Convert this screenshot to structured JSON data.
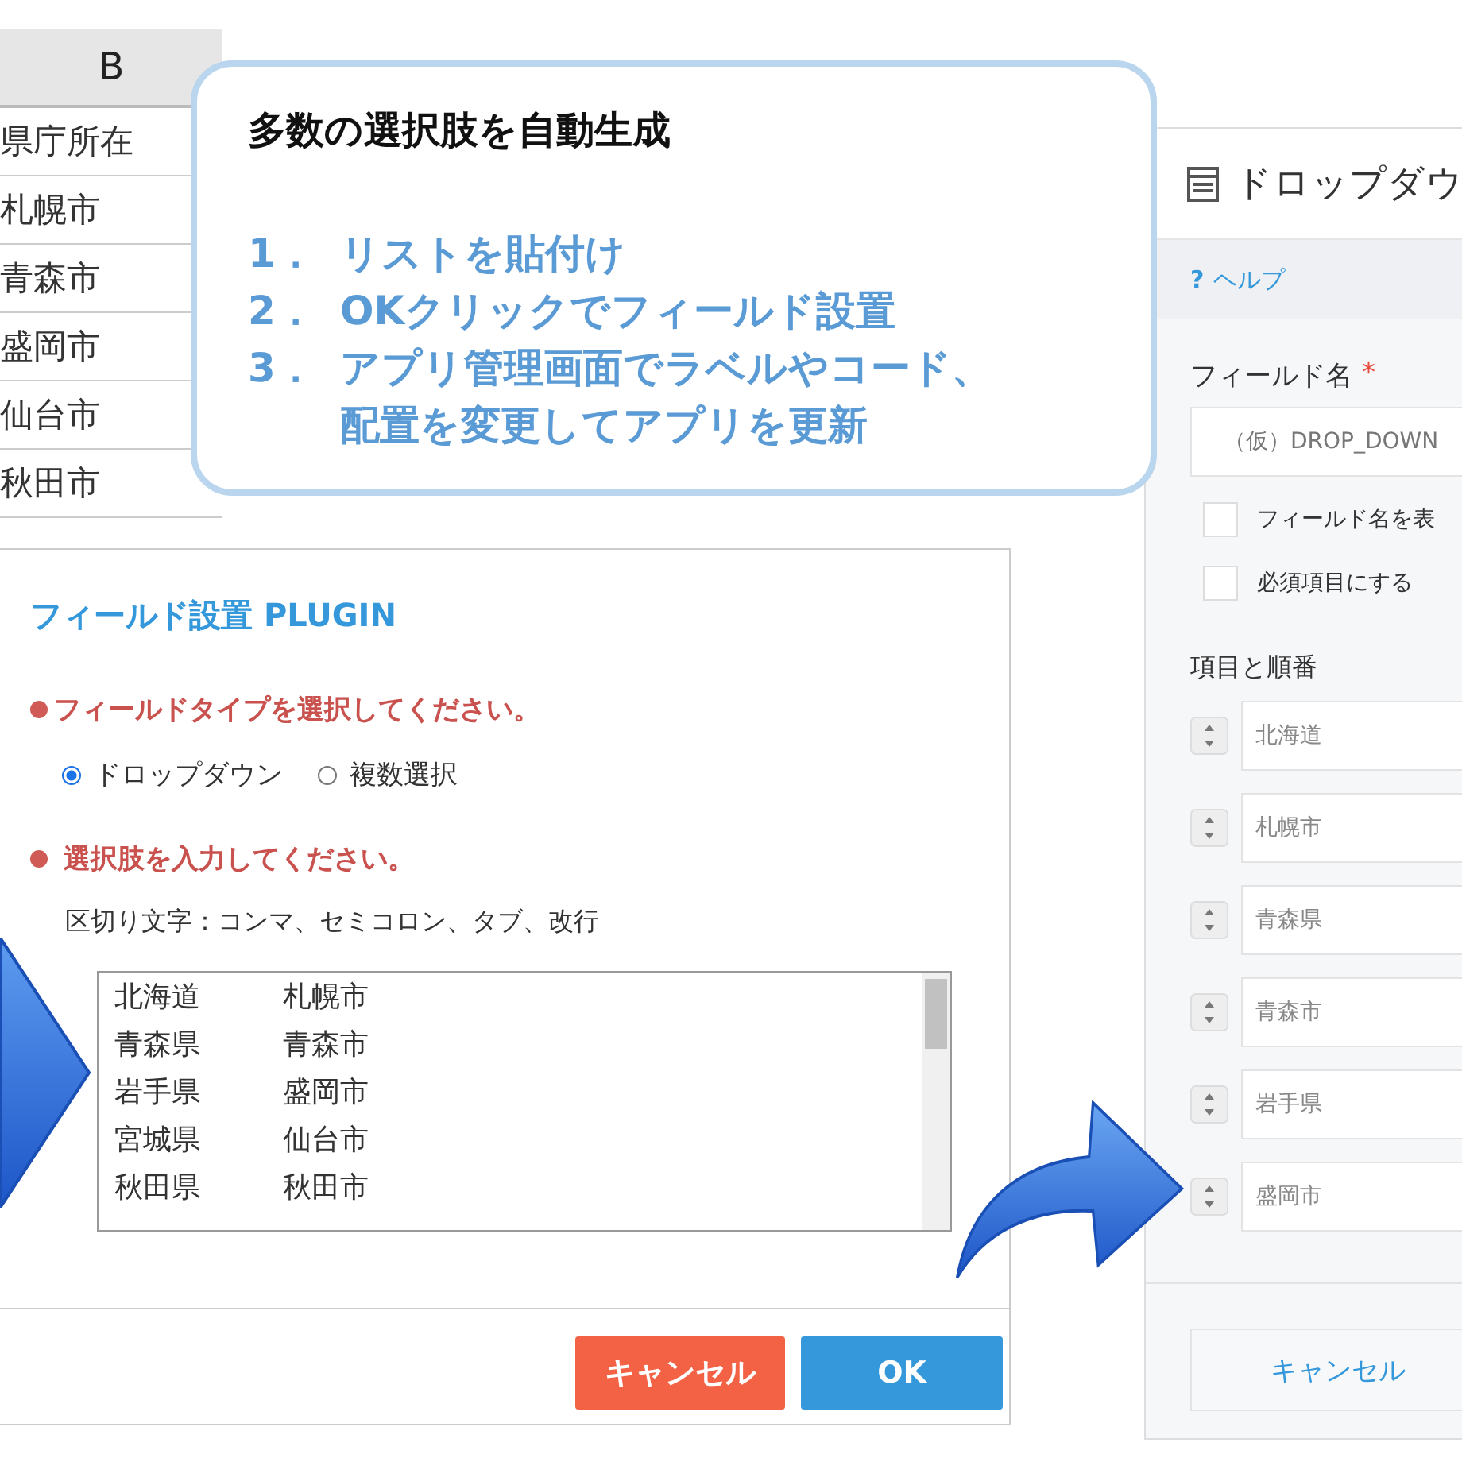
{
  "spreadsheet": {
    "column_header": "B",
    "cells": [
      "県庁所在",
      "札幌市",
      "青森市",
      "盛岡市",
      "仙台市",
      "秋田市"
    ]
  },
  "callout": {
    "title": "多数の選択肢を自動生成",
    "steps": [
      {
        "number": "1．",
        "lines": [
          "リストを貼付け"
        ]
      },
      {
        "number": "2．",
        "lines": [
          "OKクリックでフィールド設置"
        ]
      },
      {
        "number": "3．",
        "lines": [
          "アプリ管理画面でラベルやコード、",
          "配置を変更してアプリを更新"
        ]
      }
    ]
  },
  "dialog": {
    "title": "フィールド設置 PLUGIN",
    "type_prompt": "フィールドタイプを選択してください。",
    "type_options": [
      {
        "label": "ドロップダウン",
        "selected": true
      },
      {
        "label": "複数選択",
        "selected": false
      }
    ],
    "choices_prompt": "選択肢を入力してください。",
    "delimiter_hint": "区切り文字：コンマ、セミコロン、タブ、改行",
    "choices_rows": [
      {
        "column_1": "北海道",
        "column_2": "札幌市"
      },
      {
        "column_1": "青森県",
        "column_2": "青森市"
      },
      {
        "column_1": "岩手県",
        "column_2": "盛岡市"
      },
      {
        "column_1": "宮城県",
        "column_2": "仙台市"
      },
      {
        "column_1": "秋田県",
        "column_2": "秋田市"
      }
    ],
    "buttons": [
      {
        "label": "キャンセル",
        "kind": "cancel"
      },
      {
        "label": "OK",
        "kind": "ok"
      }
    ]
  },
  "settings_panel": {
    "title": "ドロップダウ",
    "help_icon": "?",
    "help": "ヘルプ",
    "field_name_label": "フィールド名",
    "required_mark": "*",
    "field_name_placeholder": "（仮）DROP_DOWN",
    "checkboxes": [
      {
        "label": "フィールド名を表",
        "checked": false
      },
      {
        "label": "必須項目にする",
        "checked": false
      }
    ],
    "items_label": "項目と順番",
    "items": [
      "北海道",
      "札幌市",
      "青森県",
      "青森市",
      "岩手県",
      "盛岡市"
    ],
    "cancel_button": "キャンセル"
  }
}
